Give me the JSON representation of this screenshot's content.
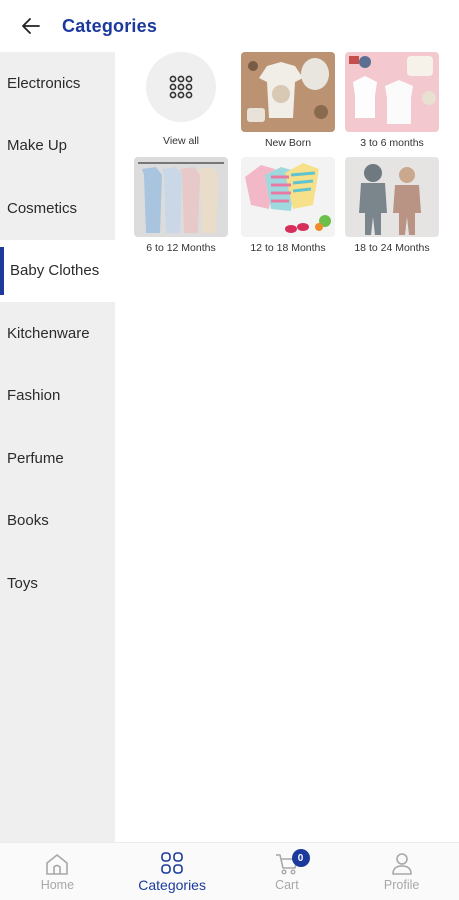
{
  "header": {
    "title": "Categories"
  },
  "sidebar": {
    "items": [
      {
        "label": "Electronics"
      },
      {
        "label": "Make Up"
      },
      {
        "label": "Cosmetics"
      },
      {
        "label": "Baby Clothes"
      },
      {
        "label": "Kitchenware"
      },
      {
        "label": "Fashion"
      },
      {
        "label": "Perfume"
      },
      {
        "label": "Books"
      },
      {
        "label": "Toys"
      }
    ],
    "active": "Baby Clothes"
  },
  "grid": {
    "view_all_label": "View all",
    "items": [
      {
        "label": "New Born"
      },
      {
        "label": "3 to 6 months"
      },
      {
        "label": "6 to 12 Months"
      },
      {
        "label": "12 to 18 Months"
      },
      {
        "label": "18 to 24 Months"
      }
    ]
  },
  "bottom_nav": {
    "items": [
      {
        "label": "Home",
        "icon": "home-icon"
      },
      {
        "label": "Categories",
        "icon": "categories-icon"
      },
      {
        "label": "Cart",
        "icon": "cart-icon"
      },
      {
        "label": "Profile",
        "icon": "profile-icon"
      }
    ],
    "active": "Categories",
    "cart_badge": "0"
  },
  "colors": {
    "accent": "#1b3a9c",
    "sidebar_bg": "#efefef",
    "inactive_nav": "#a8a8a8"
  }
}
